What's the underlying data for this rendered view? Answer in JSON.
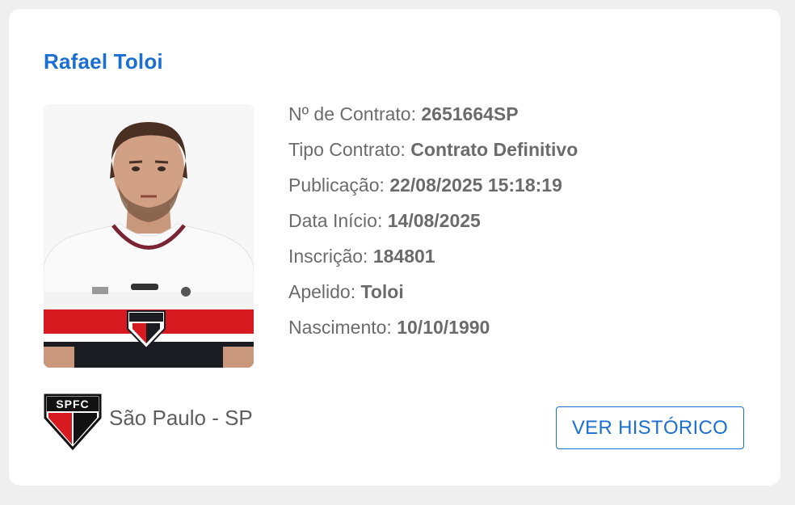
{
  "player": {
    "name": "Rafael Toloi",
    "photo_icon": "player-portrait"
  },
  "details": [
    {
      "label": "Nº de Contrato: ",
      "value": "2651664SP"
    },
    {
      "label": "Tipo Contrato: ",
      "value": "Contrato Definitivo"
    },
    {
      "label": "Publicação: ",
      "value": "22/08/2025 15:18:19"
    },
    {
      "label": "Data Início: ",
      "value": "14/08/2025"
    },
    {
      "label": "Inscrição: ",
      "value": "184801"
    },
    {
      "label": "Apelido: ",
      "value": "Toloi"
    },
    {
      "label": "Nascimento: ",
      "value": "10/10/1990"
    }
  ],
  "club": {
    "name": "São Paulo - SP",
    "crest_icon": "spfc-crest",
    "crest_text": "SPFC"
  },
  "actions": {
    "history_label": "VER HISTÓRICO"
  },
  "colors": {
    "accent": "#1a6fd0",
    "text": "#6b6b6b",
    "club_red": "#d71920",
    "club_black": "#111111"
  }
}
